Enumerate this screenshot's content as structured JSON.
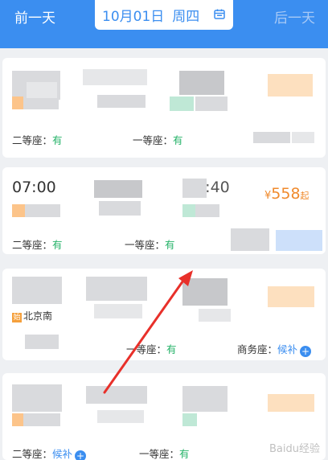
{
  "header": {
    "prev_day": "前一天",
    "date": "10月01日",
    "weekday": "周四",
    "next_day": "后一天",
    "bar_color": "#3b8ef0",
    "calendar_icon": "calendar-icon"
  },
  "trains": [
    {
      "seats": [
        {
          "label": "二等座：",
          "status": "有"
        },
        {
          "label": "一等座：",
          "status": "有"
        }
      ]
    },
    {
      "depart_time": "07:00",
      "arrive_time_partial": "11:40",
      "price_symbol": "¥",
      "price": "558",
      "price_suffix": "起",
      "seats": [
        {
          "label": "二等座：",
          "status": "有"
        },
        {
          "label": "一等座：",
          "status": "有"
        }
      ]
    },
    {
      "station_badge": "始",
      "station": "北京南",
      "seats": [
        {
          "label": "一等座：",
          "status": "有"
        },
        {
          "label": "商务座：",
          "status": "候补"
        }
      ]
    },
    {
      "seats": [
        {
          "label": "二等座：",
          "status": "候补"
        },
        {
          "label": "一等座：",
          "status": "有"
        }
      ]
    }
  ],
  "colors": {
    "available": "#27b36a",
    "waitlist": "#3b8ef0",
    "price": "#f08a2c"
  },
  "watermark": "Baidu经验"
}
